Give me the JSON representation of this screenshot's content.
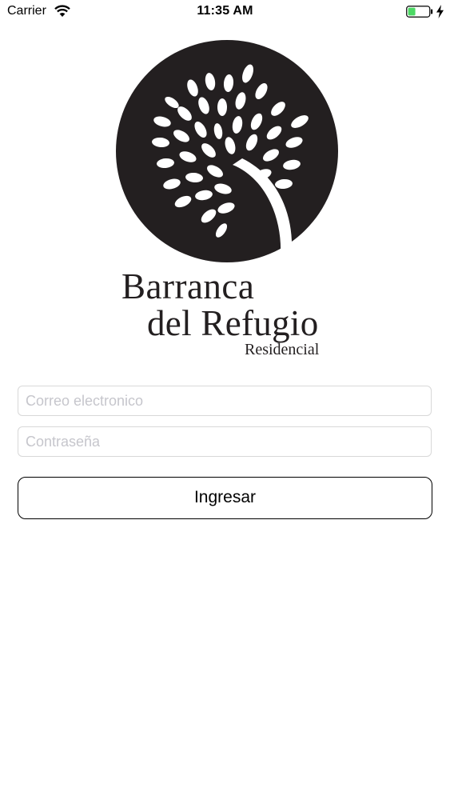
{
  "status_bar": {
    "carrier": "Carrier",
    "time": "11:35 AM",
    "icons": [
      "wifi-icon",
      "battery-icon",
      "charging-bolt-icon"
    ],
    "battery_color": "#4cd964"
  },
  "logo": {
    "line1": "Barranca",
    "line2": "del Refugio",
    "line3": "Residencial",
    "color": "#231f20"
  },
  "form": {
    "email_placeholder": "Correo electronico",
    "email_value": "",
    "password_placeholder": "Contraseña",
    "password_value": "",
    "submit_label": "Ingresar"
  }
}
